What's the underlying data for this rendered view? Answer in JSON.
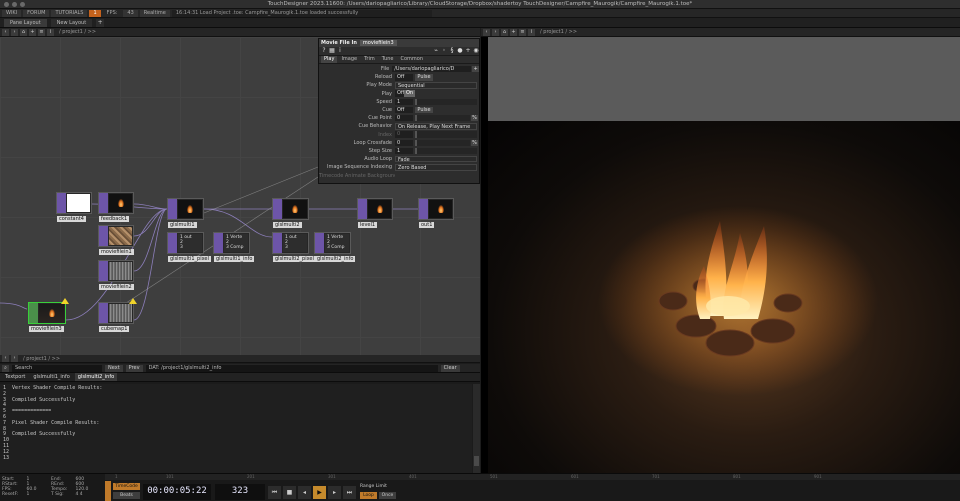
{
  "window": {
    "title": "TouchDesigner 2023.11600: /Users/dariopagliarico/Library/CloudStorage/Dropbox/shadertoy TouchDesigner/Campfire_Maurogik/Campfire_Maurogik.1.toe*"
  },
  "menubar": {
    "wiki": "WIKI",
    "forum": "FORUM",
    "tutorials": "TUTORIALS",
    "alert_badge": "1",
    "fps_label": "FPS:",
    "fps_value": "43",
    "realtime": "Realtime",
    "log_message": "16:14:31 Load Project .toe: Campfire_Maurogik.1.toe loaded successfully"
  },
  "tabbar": {
    "pane_layout": "Pane Layout",
    "new_layout": "New Layout",
    "add": "+"
  },
  "network_pane": {
    "path": "/ project1 / >>"
  },
  "viewer_pane": {
    "path": "/ project1 / >>"
  },
  "text_pane": {
    "path": "/ project1 / >>"
  },
  "nodes": [
    {
      "label": "constant4"
    },
    {
      "label": "feedback1"
    },
    {
      "label": "moviefilein1"
    },
    {
      "label": "moviefilein2"
    },
    {
      "label": "moviefilein3"
    },
    {
      "label": "cubemap1"
    },
    {
      "label": "glslmulti1"
    },
    {
      "label": "glslmulti1_pixel"
    },
    {
      "label": "glslmulti1_info"
    },
    {
      "label": "glslmulti2"
    },
    {
      "label": "glslmulti2_pixel"
    },
    {
      "label": "glslmulti2_info"
    },
    {
      "label": "level1"
    },
    {
      "label": "out1"
    }
  ],
  "node_text_thumbs": {
    "pixel": "1 out\n2\n3",
    "info": "1 Verte\n2\n3 Comp"
  },
  "params": {
    "op_type": "Movie File In",
    "op_name": "moviefilein3",
    "tabs": [
      "Play",
      "Image",
      "Trim",
      "Tune",
      "Common"
    ],
    "rows": {
      "file": {
        "label": "File",
        "value": "/Users/dariopagliarico/D"
      },
      "reload": {
        "label": "Reload",
        "value": "Off",
        "button": "Pulse"
      },
      "play_mode": {
        "label": "Play Mode",
        "value": "Sequential"
      },
      "play": {
        "label": "Play",
        "off": "Off",
        "on": "On"
      },
      "speed": {
        "label": "Speed",
        "value": "1"
      },
      "cue": {
        "label": "Cue",
        "value": "Off",
        "button": "Pulse"
      },
      "cue_point": {
        "label": "Cue Point",
        "value": "0",
        "unit": "%"
      },
      "cue_behavior": {
        "label": "Cue Behavior",
        "value": "On Release, Play Next Frame"
      },
      "index": {
        "label": "Index",
        "value": "0"
      },
      "loop_crossfade": {
        "label": "Loop Crossfade",
        "value": "0",
        "unit": "%"
      },
      "step_size": {
        "label": "Step Size",
        "value": "1"
      },
      "audio_loop": {
        "label": "Audio Loop",
        "value": "Fade"
      },
      "image_sequence_indexing": {
        "label": "Image Sequence Indexing",
        "value": "Zero Based"
      },
      "truncated": {
        "label": "Timecode Animate Background"
      }
    }
  },
  "search": {
    "label": "Search",
    "next": "Next",
    "prev": "Prev",
    "dat_label": "DAT:",
    "dat_path": "/project1/glslmulti2_info",
    "clear": "Clear"
  },
  "text_tabs": [
    "Textport",
    "glslmulti1_info",
    "glslmulti2_info"
  ],
  "text_lines": [
    "1  Vertex Shader Compile Results:",
    "2",
    "3  Compiled Successfully",
    "4",
    "5  =============",
    "6",
    "7  Pixel Shader Compile Results:",
    "8",
    "9  Compiled Successfully",
    "10",
    "11",
    "12",
    "13"
  ],
  "timeline": {
    "ruler_ticks": [
      "1",
      "101",
      "201",
      "301",
      "401",
      "501",
      "601",
      "701",
      "801",
      "901"
    ],
    "stats": [
      [
        "Start:",
        "1",
        "End:",
        "600"
      ],
      [
        "RStart:",
        "1",
        "REnd:",
        "600"
      ],
      [
        "FPS:",
        "60.0",
        "Tempo:",
        "120.0"
      ],
      [
        "ResetF:",
        "1",
        "T Sig:",
        "4  4"
      ]
    ],
    "timecode_button": "TimeCode",
    "beats_button": "Beats",
    "timecode": "00:00:05:22",
    "frame": "323",
    "range_limit": "Range Limit",
    "loop": "Loop",
    "once": "Once"
  }
}
